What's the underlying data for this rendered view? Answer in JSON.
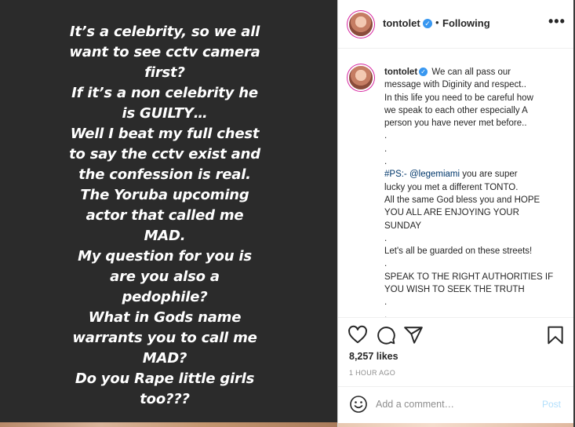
{
  "story": {
    "lines": [
      "It’s a celebrity, so we all",
      "want to see cctv camera",
      "first?",
      "If it’s a non celebrity he",
      "is GUILTY…",
      "Well I beat my full chest",
      "to say the cctv exist and",
      "the confession is real.",
      "The Yoruba upcoming",
      "actor that called me",
      "MAD.",
      "My question for you is",
      "are you also a",
      "pedophile?",
      "What in Gods name",
      "warrants you to call me",
      "MAD?",
      "Do you Rape little girls",
      "too???"
    ]
  },
  "header": {
    "username": "tontolet",
    "verified": "✓",
    "separator": "•",
    "follow_status": "Following",
    "more": "•••"
  },
  "caption": {
    "username": "tontolet",
    "first_line_rest": "We can all pass our",
    "lines": [
      "message with Diginity and respect..",
      "In this life you need to be careful how",
      "we speak to each other especially A",
      "person you have never met before..",
      ".",
      ".",
      "."
    ],
    "ps_prefix": "#PS:- ",
    "ps_mention": "@legemiami",
    "ps_rest": " you are super",
    "lines2": [
      "lucky you met a different TONTO.",
      "All the same God bless you and HOPE",
      "YOU ALL ARE ENJOYING YOUR",
      "SUNDAY",
      ".",
      "Let's all be guarded on these streets!",
      ".",
      "SPEAK TO THE RIGHT AUTHORITIES IF",
      "YOU WISH TO SEEK THE TRUTH",
      ".",
      "."
    ]
  },
  "actions": {
    "icons": [
      "heart-icon",
      "comment-icon",
      "share-icon",
      "bookmark-icon"
    ]
  },
  "likes": "8,257 likes",
  "timestamp": "1 HOUR AGO",
  "comment": {
    "placeholder": "Add a comment…",
    "post_label": "Post"
  },
  "colors": {
    "story_bg": "#2b2b2b",
    "verified_blue": "#3897f0",
    "mention": "#00376b",
    "post_disabled": "#b2dffc"
  }
}
